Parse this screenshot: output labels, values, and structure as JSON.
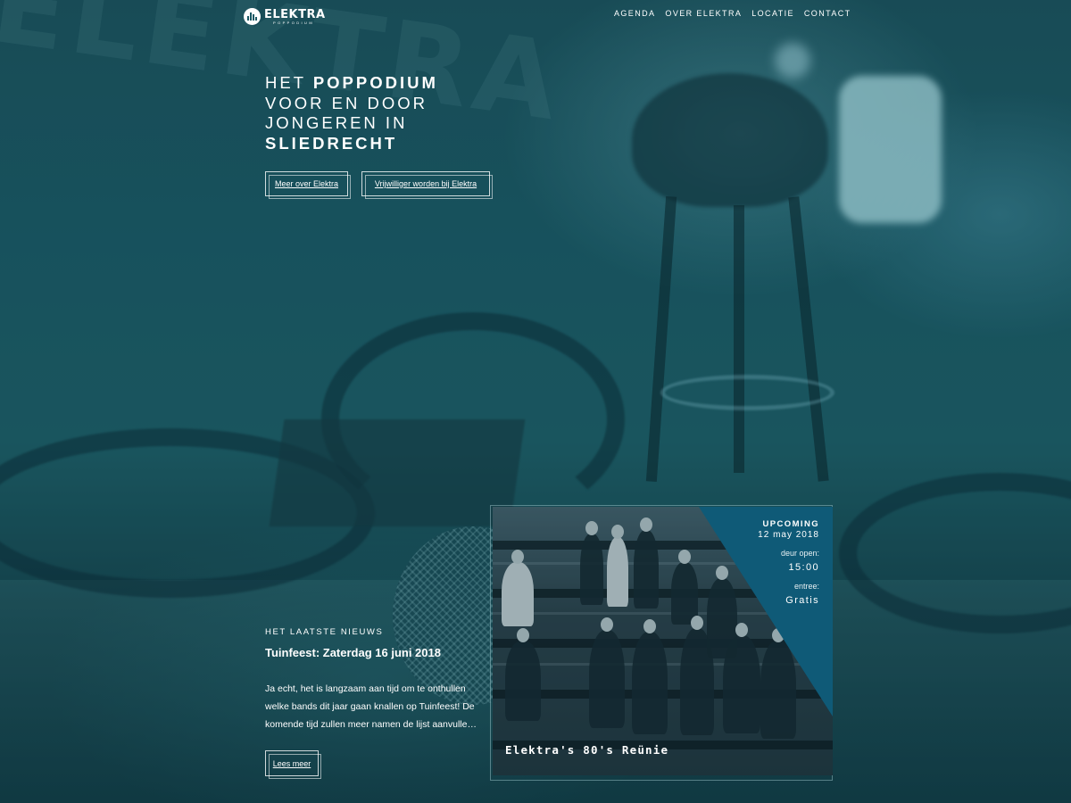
{
  "header": {
    "logo_name": "ELEKTRA",
    "logo_sub": "POPPODIUM",
    "nav": [
      "AGENDA",
      "OVER ELEKTRA",
      "LOCATIE",
      "CONTACT"
    ]
  },
  "hero": {
    "line1_regular": "HET ",
    "line1_bold": "POPPODIUM",
    "line2": "VOOR EN DOOR",
    "line3": "JONGEREN IN",
    "line4_bold": "SLIEDRECHT",
    "button_about": "Meer over Elektra",
    "button_volunteer": "Vrijwilliger worden bij Elektra"
  },
  "news": {
    "kicker": "HET LAATSTE NIEUWS",
    "title": "Tuinfeest: Zaterdag 16 juni 2018",
    "excerpt": "Ja echt, het is langzaam aan tijd om te onthullen welke bands dit jaar gaan knallen op Tuinfeest! De komende tijd zullen meer namen de lijst aanvulle…",
    "read_more": "Lees meer"
  },
  "event": {
    "tag": "UPCOMING",
    "date": "12 may 2018",
    "door_label": "deur open:",
    "door_time": "15:00",
    "entry_label": "entree:",
    "entry_value": "Gratis",
    "title": "Elektra's 80's Reünie"
  },
  "colors": {
    "background_teal": "#1a5560",
    "upcoming_panel": "#0f5a77",
    "text": "#ffffff"
  }
}
